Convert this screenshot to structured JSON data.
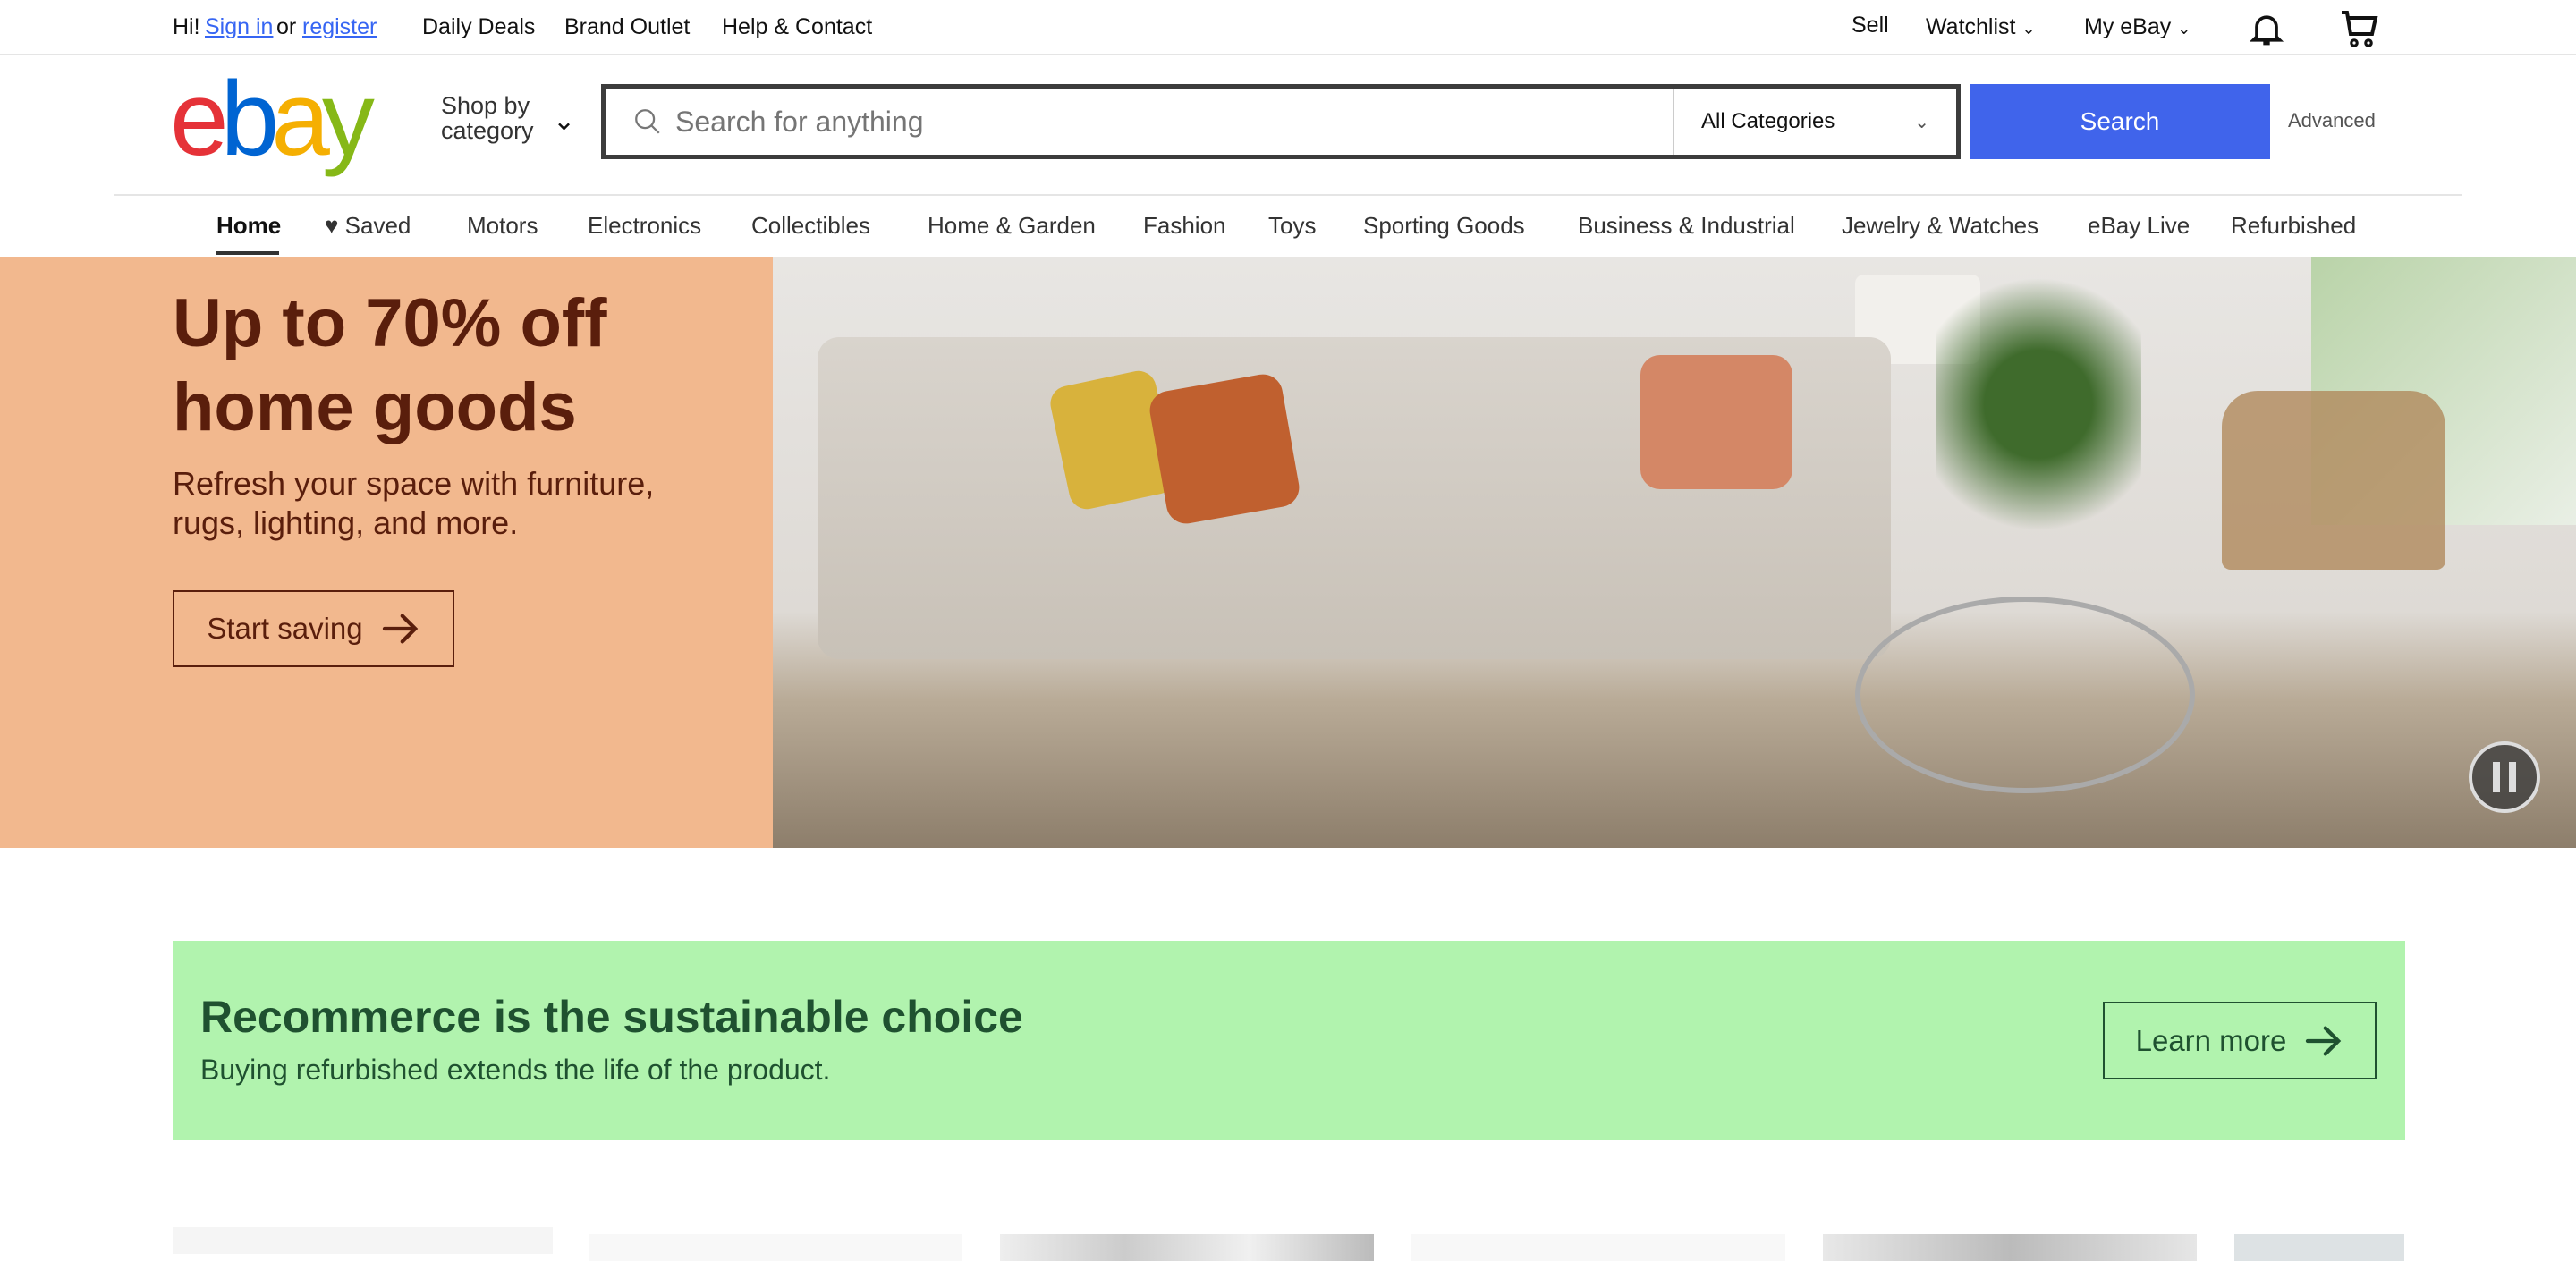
{
  "topbar": {
    "greeting": "Hi!",
    "sign_in": "Sign in",
    "or": "or",
    "register": "register",
    "links": [
      "Daily Deals",
      "Brand Outlet",
      "Help & Contact"
    ],
    "sell": "Sell",
    "watchlist": "Watchlist",
    "my_ebay": "My eBay"
  },
  "header": {
    "logo": "ebay",
    "shop_by_category": "Shop by category",
    "search_placeholder": "Search for anything",
    "category_select": "All Categories",
    "search_button": "Search",
    "advanced": "Advanced"
  },
  "nav": {
    "items": [
      "Home",
      "Saved",
      "Motors",
      "Electronics",
      "Collectibles",
      "Home & Garden",
      "Fashion",
      "Toys",
      "Sporting Goods",
      "Business & Industrial",
      "Jewelry & Watches",
      "eBay Live",
      "Refurbished"
    ],
    "active": "Home"
  },
  "hero": {
    "title_line1": "Up to 70% off",
    "title_line2": "home goods",
    "subtitle_line1": "Refresh your space with furniture,",
    "subtitle_line2": "rugs, lighting, and more.",
    "cta": "Start saving",
    "bg_color": "#f2b88e",
    "text_color": "#5a1e0c"
  },
  "promo": {
    "title": "Recommerce is the sustainable choice",
    "subtitle": "Buying refurbished extends the life of the product.",
    "cta": "Learn more",
    "bg_color": "#b1f3ae",
    "text_color": "#1f5130"
  },
  "colors": {
    "search_button": "#4064eb",
    "link": "#3665f3"
  }
}
